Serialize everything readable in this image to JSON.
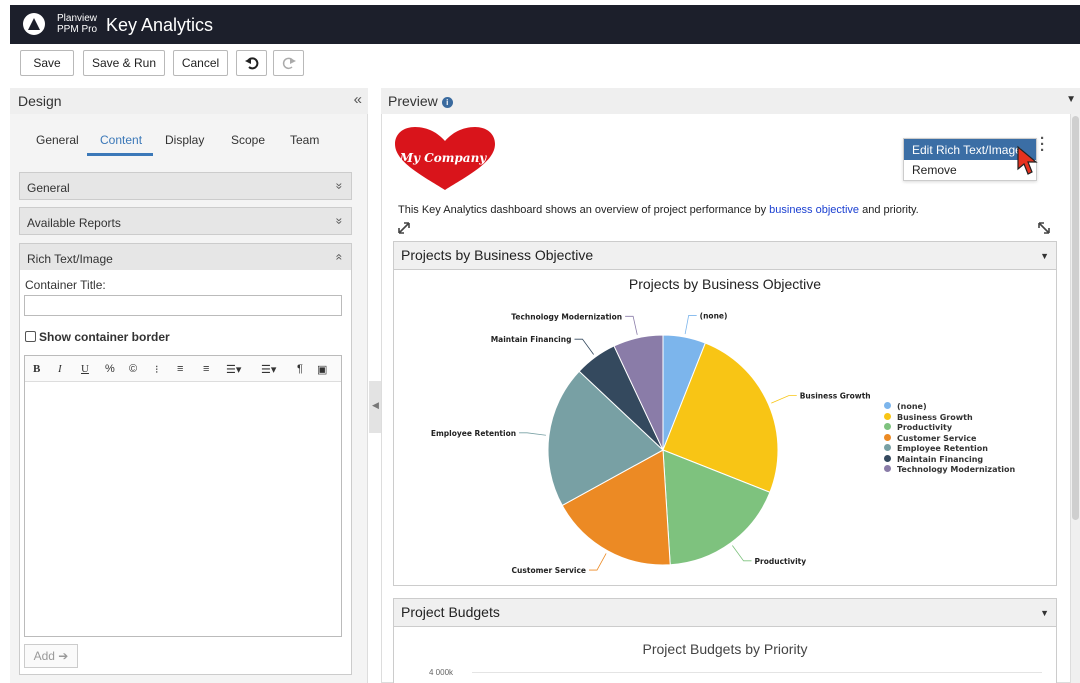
{
  "app": {
    "brand_line1": "Planview",
    "brand_line2": "PPM Pro",
    "title": "Key Analytics"
  },
  "toolbar": {
    "save": "Save",
    "save_run": "Save & Run",
    "cancel": "Cancel",
    "undo_icon": "undo-icon",
    "redo_icon": "redo-icon"
  },
  "design": {
    "title": "Design",
    "collapse_icon": "«",
    "tabs": [
      "General",
      "Content",
      "Display",
      "Scope",
      "Team"
    ],
    "active_tab": "Content",
    "sections": [
      {
        "label": "General",
        "chevron": "»"
      },
      {
        "label": "Available Reports",
        "chevron": "»"
      },
      {
        "label": "Rich Text/Image",
        "chevron": "«"
      }
    ],
    "container_title_label": "Container Title:",
    "container_title_value": "",
    "show_border_label": "Show container border",
    "show_border_checked": false,
    "editor_buttons": [
      "B",
      "I",
      "U",
      "%",
      "©",
      "⁝",
      "≡",
      "≡",
      "☰▾",
      "☰▾",
      "¶",
      "▣"
    ],
    "add_label": "Add ➔"
  },
  "preview": {
    "title": "Preview",
    "info_icon": "i",
    "logo_text": "My Company",
    "description_before": "This Key Analytics dashboard shows an overview of project performance by ",
    "description_link": "business objective",
    "description_after": " and priority.",
    "context_menu": [
      "Edit Rich Text/Image",
      "Remove"
    ],
    "panel1_title": "Projects by Business Objective",
    "panel2_title": "Project Budgets",
    "budget_chart_title": "Project Budgets by Priority",
    "budget_axis_tick": "4 000k"
  },
  "colors": {
    "topbar": "#1c1f2b",
    "accent": "#3b78b8",
    "menu_highlight": "#3b6ea5",
    "logo_heart": "#d9141b"
  },
  "chart_data": {
    "type": "pie",
    "title": "Projects by Business Objective",
    "categories": [
      "(none)",
      "Business Growth",
      "Productivity",
      "Customer Service",
      "Employee Retention",
      "Maintain Financing",
      "Technology Modernization"
    ],
    "values": [
      6,
      25,
      18,
      18,
      20,
      6,
      7
    ],
    "colors": [
      "#7cb5ec",
      "#f8c515",
      "#7ec27e",
      "#ec8a24",
      "#78a0a4",
      "#34495e",
      "#8a7ca8"
    ],
    "legend_position": "right"
  }
}
